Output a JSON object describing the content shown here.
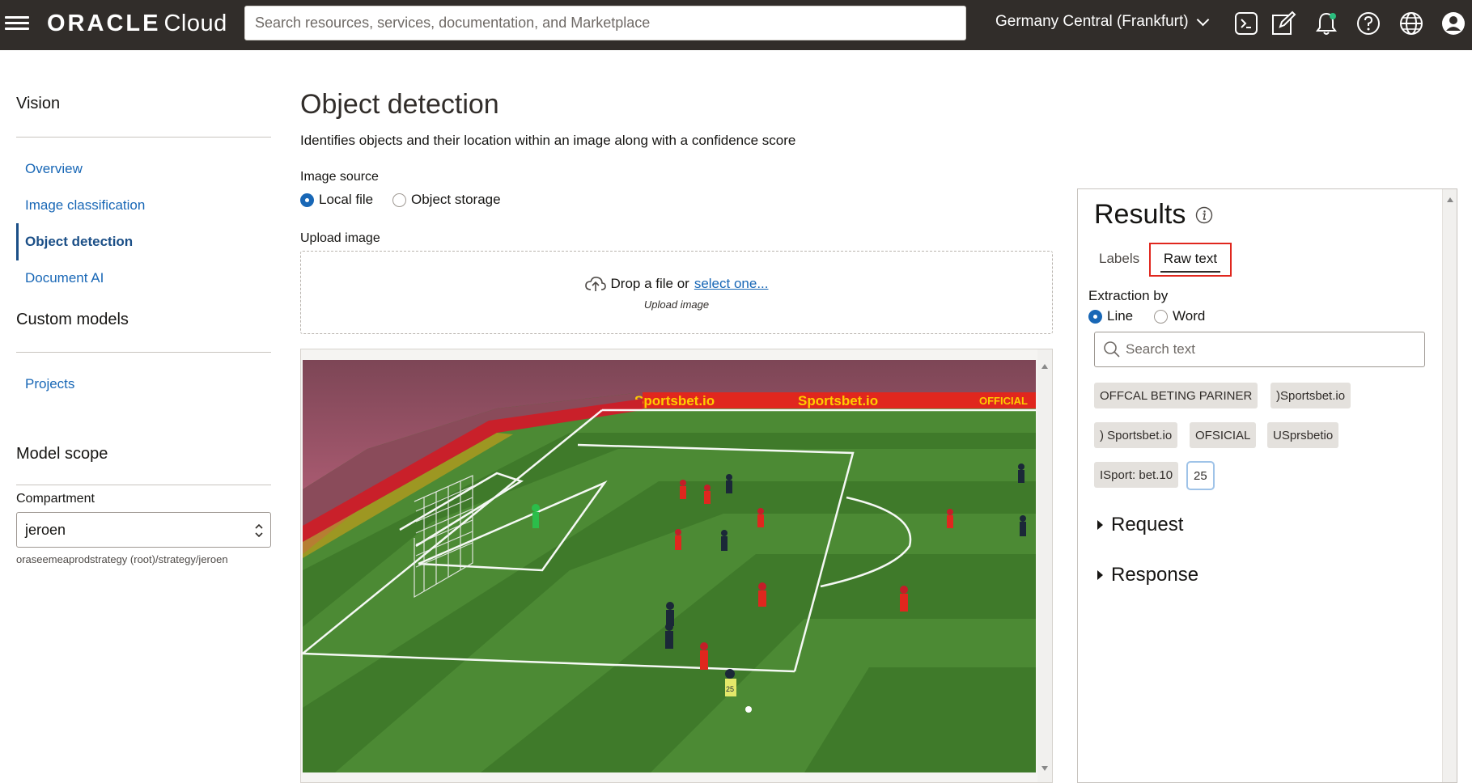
{
  "header": {
    "brand_oracle": "ORACLE",
    "brand_cloud": "Cloud",
    "search_placeholder": "Search resources, services, documentation, and Marketplace",
    "region": "Germany Central (Frankfurt)",
    "icons": [
      "cloud-shell-icon",
      "edit-icon",
      "bell-icon",
      "help-icon",
      "globe-icon",
      "user-icon"
    ]
  },
  "sidebar": {
    "section_title": "Vision",
    "items": [
      {
        "label": "Overview",
        "active": false
      },
      {
        "label": "Image classification",
        "active": false
      },
      {
        "label": "Object detection",
        "active": true
      },
      {
        "label": "Document AI",
        "active": false
      }
    ],
    "custom_models_title": "Custom models",
    "custom_items": [
      {
        "label": "Projects"
      }
    ],
    "model_scope_title": "Model scope",
    "compartment_label": "Compartment",
    "compartment_value": "jeroen",
    "compartment_path": "oraseemeaprodstrategy (root)/strategy/jeroen"
  },
  "main": {
    "title": "Object detection",
    "description": "Identifies objects and their location within an image along with a confidence score",
    "image_source_label": "Image source",
    "image_source_options": [
      {
        "label": "Local file",
        "checked": true
      },
      {
        "label": "Object storage",
        "checked": false
      }
    ],
    "upload_label": "Upload image",
    "drop_text": "Drop a file or",
    "drop_link": "select one...",
    "drop_sub": "Upload image",
    "image_overlay": {
      "ad_text_1": "Sportsbet.io",
      "ad_text_2": "Sportsbet.io",
      "ad_text_3": "OFFICIAL",
      "jersey_number": "25"
    }
  },
  "results": {
    "title": "Results",
    "tabs": [
      {
        "label": "Labels",
        "active": false
      },
      {
        "label": "Raw text",
        "active": true
      }
    ],
    "extraction_label": "Extraction by",
    "extraction_options": [
      {
        "label": "Line",
        "checked": true
      },
      {
        "label": "Word",
        "checked": false
      }
    ],
    "search_placeholder": "Search text",
    "chips": [
      {
        "label": "OFFCAL BETING PARINER",
        "selected": false
      },
      {
        "label": ")Sportsbet.io",
        "selected": false
      },
      {
        "label": ") Sportsbet.io",
        "selected": false
      },
      {
        "label": "OFSICIAL",
        "selected": false
      },
      {
        "label": "USprsbetio",
        "selected": false
      },
      {
        "label": "ISport: bet.10",
        "selected": false
      },
      {
        "label": "25",
        "selected": true
      }
    ],
    "request_label": "Request",
    "response_label": "Response"
  },
  "colors": {
    "header_bg": "#312d2a",
    "link_blue": "#1867b6",
    "active_nav": "#1b4f87",
    "highlight_red": "#e0271e",
    "pitch_green": "#3f7a2a"
  }
}
